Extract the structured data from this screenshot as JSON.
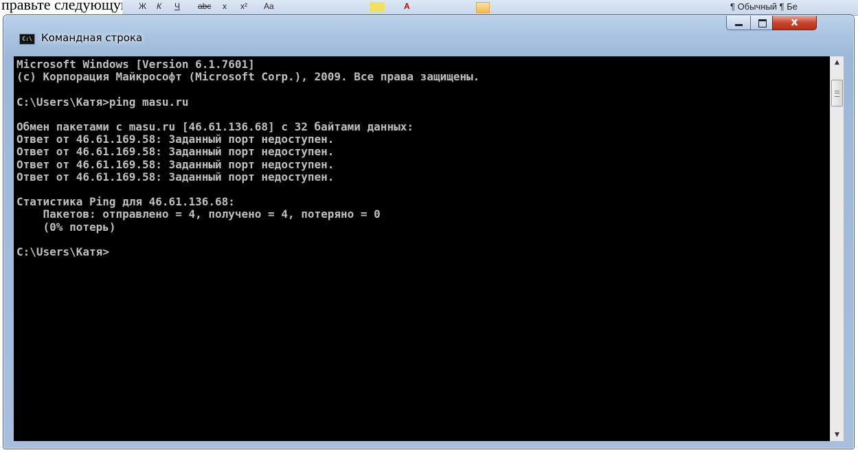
{
  "background": {
    "doc_text": "правьте следующую команду:",
    "ribbon_text": "¶ Обычный  ¶ Бе",
    "ribbon_items": [
      "Ж",
      "К",
      "Ч",
      "abc",
      "x",
      "x²",
      "Aa",
      "A"
    ]
  },
  "window": {
    "title": "Командная строка",
    "icon": "console-icon",
    "controls": {
      "minimize": "minimize-icon",
      "maximize": "maximize-icon",
      "close": "close-icon"
    }
  },
  "console": {
    "lines": [
      "Microsoft Windows [Version 6.1.7601]",
      "(c) Корпорация Майкрософт (Microsoft Corp.), 2009. Все права защищены.",
      "",
      "C:\\Users\\Катя>ping masu.ru",
      "",
      "Обмен пакетами с masu.ru [46.61.136.68] с 32 байтами данных:",
      "Ответ от 46.61.169.58: Заданный порт недоступен.",
      "Ответ от 46.61.169.58: Заданный порт недоступен.",
      "Ответ от 46.61.169.58: Заданный порт недоступен.",
      "Ответ от 46.61.169.58: Заданный порт недоступен.",
      "",
      "Статистика Ping для 46.61.136.68:",
      "    Пакетов: отправлено = 4, получено = 4, потеряно = 0",
      "    (0% потерь)",
      "",
      "C:\\Users\\Катя>"
    ],
    "colors": {
      "background": "#000000",
      "text": "#c0c0c0"
    }
  },
  "scrollbar": {
    "up": "▲",
    "down": "▼"
  }
}
